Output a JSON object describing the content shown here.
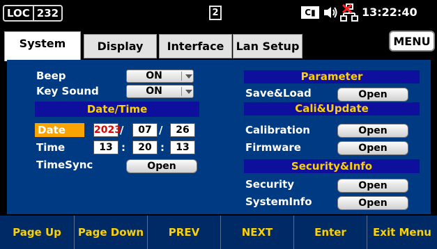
{
  "status_bar": {
    "loc": "LOC",
    "channel": "232",
    "tab_count": "2",
    "ce_badge": "C",
    "icons": [
      "speaker-icon",
      "lan-disconnected-icon"
    ],
    "time": "13:22:40"
  },
  "tabs": [
    {
      "label": "System",
      "active": true
    },
    {
      "label": "Display",
      "active": false
    },
    {
      "label": "Interface",
      "active": false
    },
    {
      "label": "Lan Setup",
      "active": false
    }
  ],
  "menu_label": "MENU",
  "left": {
    "beep": {
      "label": "Beep",
      "value": "ON"
    },
    "key_sound": {
      "label": "Key Sound",
      "value": "ON"
    },
    "datetime_header": "Date/Time",
    "date": {
      "label": "Date",
      "year": "2023",
      "month": "07",
      "day": "26"
    },
    "time": {
      "label": "Time",
      "hour": "13",
      "minute": "20",
      "second": "13"
    },
    "timesync": {
      "label": "TimeSync",
      "button": "Open"
    }
  },
  "right": {
    "parameter_header": "Parameter",
    "save_load": {
      "label": "Save&Load",
      "button": "Open"
    },
    "cali_header": "Cali&Update",
    "calibration": {
      "label": "Calibration",
      "button": "Open"
    },
    "firmware": {
      "label": "Firmware",
      "button": "Open"
    },
    "security_header": "Security&Info",
    "security": {
      "label": "Security",
      "button": "Open"
    },
    "systeminfo": {
      "label": "SystemInfo",
      "button": "Open"
    }
  },
  "softkeys": [
    "Page Up",
    "Page Down",
    "PREV",
    "NEXT",
    "Enter",
    "Exit Menu"
  ],
  "colors": {
    "panel_bg": "#003a82",
    "header_bg": "#0e0f9c",
    "header_text": "#fdd000",
    "softkey_text": "#fdd000",
    "selected_bg": "#f9a400",
    "year_text": "#e00000"
  }
}
